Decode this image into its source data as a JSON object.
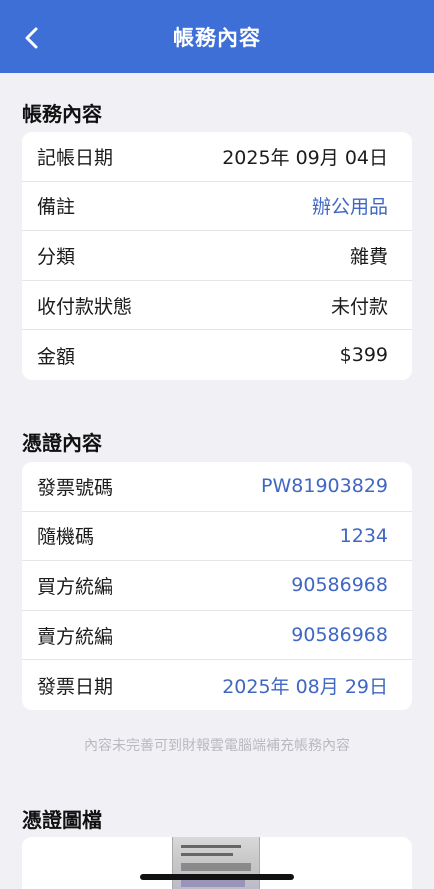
{
  "header": {
    "title": "帳務內容",
    "back_icon": "chevron-left-icon"
  },
  "billing": {
    "section_title": "帳務內容",
    "rows": [
      {
        "label": "記帳日期",
        "value": "2025年 09月 04日",
        "style": "plain"
      },
      {
        "label": "備註",
        "value": "辦公用品",
        "style": "link"
      },
      {
        "label": "分類",
        "value": "雜費",
        "style": "plain"
      },
      {
        "label": "收付款狀態",
        "value": "未付款",
        "style": "plain"
      },
      {
        "label": "金額",
        "value": "$399",
        "style": "plain"
      }
    ]
  },
  "voucher": {
    "section_title": "憑證內容",
    "rows": [
      {
        "label": "發票號碼",
        "value": "PW81903829",
        "style": "link"
      },
      {
        "label": "隨機碼",
        "value": "1234",
        "style": "link"
      },
      {
        "label": "買方統編",
        "value": "90586968",
        "style": "link"
      },
      {
        "label": "賣方統編",
        "value": "90586968",
        "style": "link"
      },
      {
        "label": "發票日期",
        "value": "2025年 08月 29日",
        "style": "link"
      }
    ]
  },
  "hint": "內容未完善可到財報雲電腦端補充帳務內容",
  "voucher_image": {
    "section_title": "憑證圖檔"
  },
  "colors": {
    "nav": "#3d6fd6",
    "link": "#3f67c3",
    "background": "#f0f0f5"
  }
}
